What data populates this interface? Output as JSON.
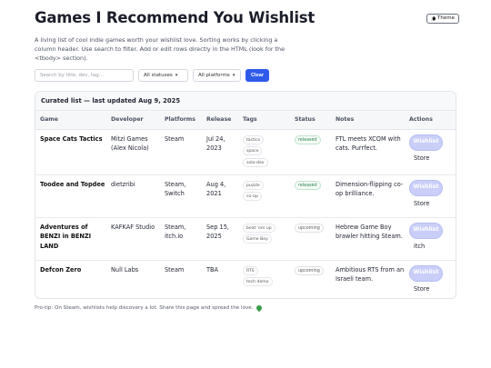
{
  "page": {
    "title": "Games I Recommend You Wishlist",
    "theme_label": "Theme",
    "intro": "A living list of cool indie games worth your wishlist love. Sorting works by clicking a column header. Use search to filter. Add or edit rows directly in the HTML (look for the <tbody> section)."
  },
  "controls": {
    "search_placeholder": "Search by title, dev, tag…",
    "status_select": "All statuses",
    "platform_select": "All platforms",
    "clear_label": "Clear"
  },
  "table": {
    "caption": "Curated list — last updated Aug 9, 2025",
    "headers": [
      "Game",
      "Developer",
      "Platforms",
      "Release",
      "Tags",
      "Status",
      "Notes",
      "Actions"
    ],
    "rows": [
      {
        "game": "Space Cats Tactics",
        "developer": "Mitzi Games (Alex Nicola)",
        "platforms": "Steam",
        "release": "Jul 24, 2023",
        "tags": [
          "tactics",
          "space",
          "solo-dev"
        ],
        "status": "released",
        "notes": "FTL meets XCOM with cats. Purrfect.",
        "wishlist": "Wishlist",
        "store": "Store"
      },
      {
        "game": "Toodee and Topdee",
        "developer": "dietzribi",
        "platforms": "Steam, Switch",
        "release": "Aug 4, 2021",
        "tags": [
          "puzzle",
          "co-op"
        ],
        "status": "released",
        "notes": "Dimension-flipping co-op brilliance.",
        "wishlist": "Wishlist",
        "store": "Store"
      },
      {
        "game": "Adventures of BENZI in BENZI LAND",
        "developer": "KAFKAF Studio",
        "platforms": "Steam, itch.io",
        "release": "Sep 15, 2025",
        "tags": [
          "beat 'em up",
          "Game Boy"
        ],
        "status": "upcoming",
        "notes": "Hebrew Game Boy brawler hitting Steam.",
        "wishlist": "Wishlist",
        "store": "itch"
      },
      {
        "game": "Defcon Zero",
        "developer": "Null Labs",
        "platforms": "Steam",
        "release": "TBA",
        "tags": [
          "RTS",
          "tech demo"
        ],
        "status": "upcoming",
        "notes": "Ambitious RTS from an Israeli team.",
        "wishlist": "Wishlist",
        "store": "Store"
      }
    ]
  },
  "footer": {
    "text": "Pro-tip: On Steam, wishlists help discovery a lot. Share this page and spread the love.",
    "icon": "green-heart-icon"
  },
  "colors": {
    "accent": "#2f5bea",
    "wishlist_button": "#c9cff8",
    "released_status": "#26864a",
    "heart": "#3a9d4a"
  }
}
